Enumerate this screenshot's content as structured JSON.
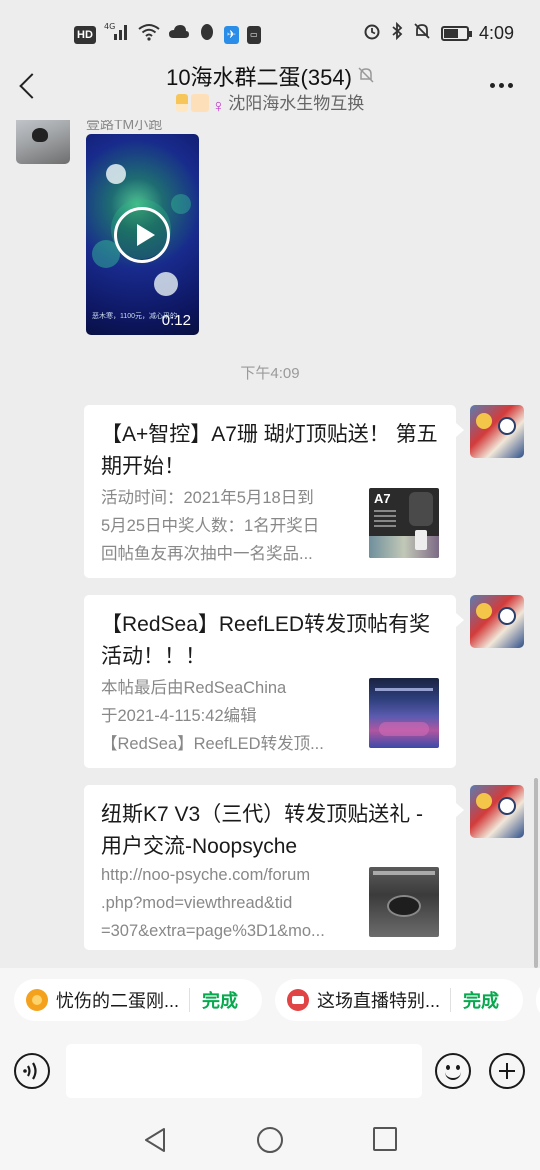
{
  "status_bar": {
    "hd": "HD",
    "network": "4G",
    "signal_icon": "signal-bars-icon",
    "time": "4:09",
    "battery_level": 0.65
  },
  "header": {
    "title": "10海水群二蛋(354)",
    "subtitle": "沈阳海水生物互换"
  },
  "chat": {
    "video_message": {
      "sender": "壹路TM小跑",
      "duration": "0:12",
      "caption": "恶木寒，1100元，减心采的"
    },
    "timestamp": "下午4:09",
    "messages": [
      {
        "title": "【A+智控】A7珊 瑚灯顶贴送！ 第五期开始！",
        "desc": [
          "活动时间：2021年5月18日到",
          "5月25日中奖人数：1名开奖日",
          "回帖鱼友再次抽中一名奖品..."
        ],
        "thumb_label": "A7"
      },
      {
        "title": "【RedSea】ReefLED转发顶帖有奖活动！！！",
        "desc": [
          "本帖最后由RedSeaChina",
          "于2021-4-115:42编辑",
          "【RedSea】ReefLED转发顶..."
        ]
      },
      {
        "title": "纽斯K7 V3（三代）转发顶贴送礼 - 用户交流-Noopsyche",
        "desc": [
          "http://noo-psyche.com/forum",
          ".php?mod=viewthread&tid",
          "=307&extra=page%3D1&mo..."
        ]
      }
    ]
  },
  "tasks": [
    {
      "label": "忧伤的二蛋刚...",
      "done": "完成",
      "icon": "orange-badge-icon"
    },
    {
      "label": "这场直播特别...",
      "done": "完成",
      "icon": "red-live-icon"
    }
  ],
  "input": {
    "placeholder": ""
  }
}
